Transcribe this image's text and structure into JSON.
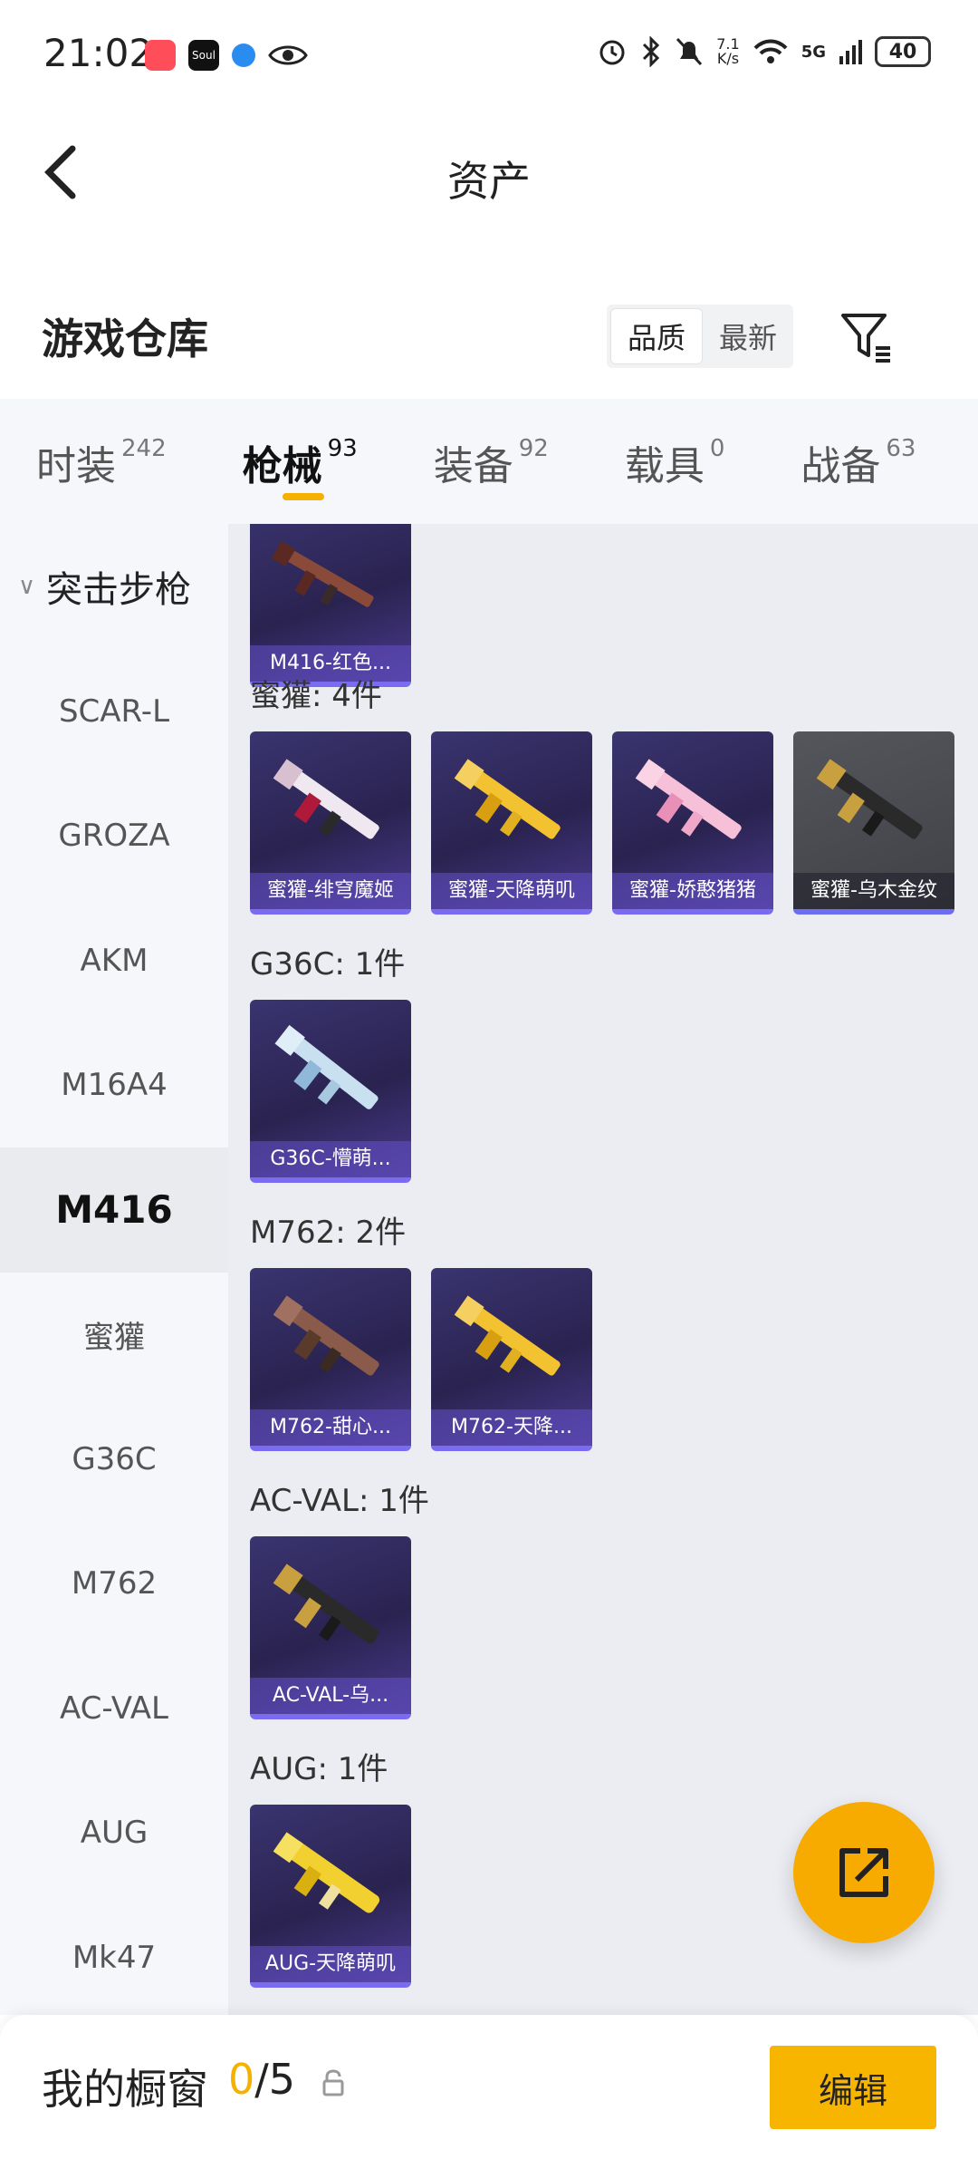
{
  "status_bar": {
    "time": "21:02",
    "network_speed": "7.1\nK/s",
    "network_type": "5G",
    "battery": "40"
  },
  "header": {
    "title": "资产"
  },
  "warehouse": {
    "label": "游戏仓库",
    "sort_options": [
      "品质",
      "最新"
    ],
    "active_sort": "品质"
  },
  "tabs": [
    {
      "label": "时装",
      "count": "242"
    },
    {
      "label": "枪械",
      "count": "93",
      "active": true
    },
    {
      "label": "装备",
      "count": "92"
    },
    {
      "label": "载具",
      "count": "0"
    },
    {
      "label": "战备",
      "count": "63"
    }
  ],
  "sidebar": {
    "group": "突击步枪",
    "items": [
      "SCAR-L",
      "GROZA",
      "AKM",
      "M16A4",
      "M416",
      "蜜獾",
      "G36C",
      "M762",
      "AC-VAL",
      "AUG",
      "Mk47"
    ],
    "active": "M416"
  },
  "sections": [
    {
      "title": "",
      "items": [
        {
          "name": "M416-红色..."
        }
      ]
    },
    {
      "title": "蜜獾: 4件",
      "items": [
        {
          "name": "蜜獾-绯穹魔姬"
        },
        {
          "name": "蜜獾-天降萌叽"
        },
        {
          "name": "蜜獾-娇憨猪猪"
        },
        {
          "name": "蜜獾-乌木金纹"
        }
      ]
    },
    {
      "title": "G36C: 1件",
      "items": [
        {
          "name": "G36C-懵萌..."
        }
      ]
    },
    {
      "title": "M762: 2件",
      "items": [
        {
          "name": "M762-甜心..."
        },
        {
          "name": "M762-天降..."
        }
      ]
    },
    {
      "title": "AC-VAL: 1件",
      "items": [
        {
          "name": "AC-VAL-乌..."
        }
      ]
    },
    {
      "title": "AUG: 1件",
      "items": [
        {
          "name": "AUG-天降萌叽"
        }
      ]
    }
  ],
  "bottom": {
    "label": "我的橱窗",
    "current": "0",
    "total": "/5",
    "edit_label": "编辑"
  },
  "colors": {
    "accent": "#f5b000",
    "card_purple": "#2a2350",
    "card_gray": "#4a4c52"
  }
}
